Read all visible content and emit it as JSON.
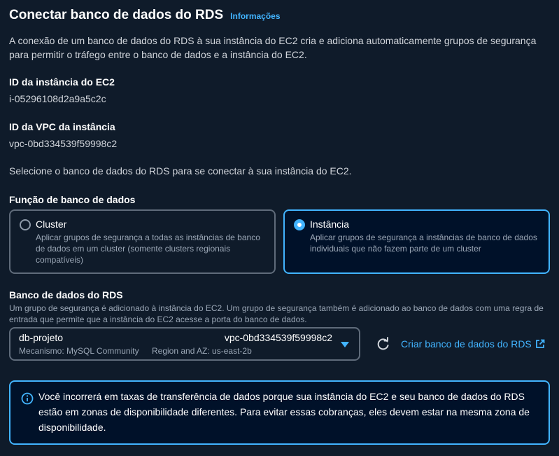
{
  "header": {
    "title": "Conectar banco de dados do RDS",
    "info_link": "Informações"
  },
  "description": "A conexão de um banco de dados do RDS à sua instância do EC2 cria e adiciona automaticamente grupos de segurança para permitir o tráfego entre o banco de dados e a instância do EC2.",
  "ec2_instance": {
    "label": "ID da instância do EC2",
    "value": "i-05296108d2a9a5c2c"
  },
  "vpc": {
    "label": "ID da VPC da instância",
    "value": "vpc-0bd334539f59998c2"
  },
  "select_message": "Selecione o banco de dados do RDS para se conectar à sua instância do EC2.",
  "db_role": {
    "label": "Função de banco de dados",
    "options": [
      {
        "title": "Cluster",
        "description": "Aplicar grupos de segurança a todas as instâncias de banco de dados em um cluster (somente clusters regionais compatíveis)",
        "selected": false
      },
      {
        "title": "Instância",
        "description": "Aplicar grupos de segurança a instâncias de banco de dados individuais que não fazem parte de um cluster",
        "selected": true
      }
    ]
  },
  "rds_database": {
    "label": "Banco de dados do RDS",
    "description": "Um grupo de segurança é adicionado à instância do EC2. Um grupo de segurança também é adicionado ao banco de dados com uma regra de entrada que permite que a instância do EC2 acesse a porta do banco de dados.",
    "selected": {
      "name": "db-projeto",
      "vpc": "vpc-0bd334539f59998c2",
      "engine": "Mecanismo: MySQL Community",
      "region": "Region and AZ: us-east-2b"
    },
    "create_link": "Criar banco de dados do RDS"
  },
  "alert": {
    "text": "Você incorrerá em taxas de transferência de dados porque sua instância do EC2 e seu banco de dados do RDS estão em zonas de disponibilidade diferentes. Para evitar essas cobranças, eles devem estar na mesma zona de disponibilidade."
  },
  "colors": {
    "background": "#0f1b2a",
    "accent": "#42b4ff",
    "border": "#5f6b7a",
    "selected_bg": "#001129"
  },
  "icons": [
    "radio-icon",
    "caret-down-icon",
    "refresh-icon",
    "external-link-icon",
    "info-icon"
  ]
}
